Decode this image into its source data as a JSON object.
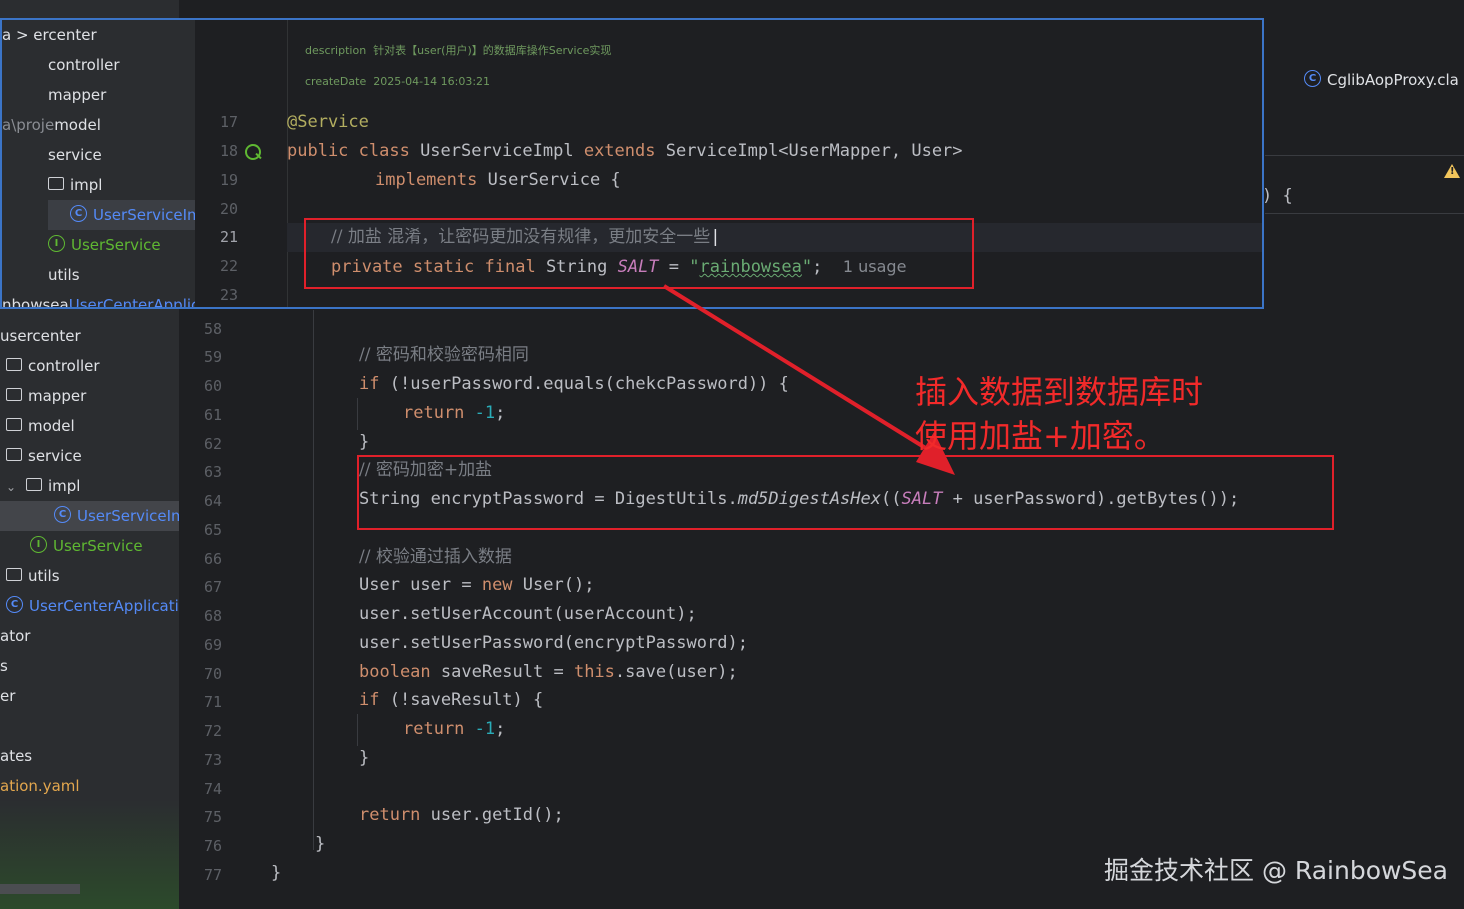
{
  "colors": {
    "annotation_red": "#e0202a",
    "keyword": "#cf8e6d",
    "string": "#6aab73",
    "comment": "#7a7e85",
    "number": "#2aacb8",
    "field": "#c77dbb",
    "class_icon": "#548af7",
    "interface_icon": "#5fb832"
  },
  "popup": {
    "sidebar": {
      "items": [
        {
          "label": "a  >  ",
          "label2": "ercenter"
        },
        {
          "label": "controller"
        },
        {
          "label": "mapper"
        },
        {
          "label": "a\\proje",
          "label2": "model"
        },
        {
          "label": "service"
        },
        {
          "label": "impl",
          "icon": "folder-icon"
        },
        {
          "label": "UserServiceIm",
          "icon": "class-icon"
        },
        {
          "label": "UserService",
          "icon": "interface-icon"
        },
        {
          "label": "utils"
        },
        {
          "label": "nbowsea",
          "label2": "UserCenterApplicati"
        }
      ]
    },
    "doc": {
      "description_label": "description",
      "description_value": "针对表【user(用户)】的数据库操作Service实现",
      "createdate_label": "createDate",
      "createdate_value": "2025-04-14 16:03:21"
    },
    "line_numbers": [
      "17",
      "18",
      "19",
      "20",
      "21",
      "22",
      "23"
    ],
    "code": {
      "l17": "@Service",
      "l18_kw1": "public class",
      "l18_name": " UserServiceImpl ",
      "l18_kw2": "extends",
      "l18_rest": " ServiceImpl<UserMapper, User>",
      "l19_kw": "implements",
      "l19_rest": " UserService {",
      "l21_comment": "// 加盐 混淆，让密码更加没有规律，更加安全一些",
      "l22_kw": "private static final",
      "l22_type": " String ",
      "l22_field": "SALT",
      "l22_eq": " = ",
      "l22_str_open": "\"",
      "l22_str": "rainbowsea",
      "l22_str_close": "\"",
      "l22_semi": ";",
      "l22_usage": "1 usage"
    }
  },
  "sidebar": {
    "items": [
      {
        "label": "usercenter"
      },
      {
        "label": "controller",
        "icon": "folder-icon"
      },
      {
        "label": "mapper",
        "icon": "folder-icon"
      },
      {
        "label": "model",
        "icon": "folder-icon"
      },
      {
        "label": "service",
        "icon": "folder-icon"
      },
      {
        "label": "impl",
        "icon": "folder-icon"
      },
      {
        "label": "UserServiceIm",
        "icon": "class-icon"
      },
      {
        "label": "UserService",
        "icon": "interface-icon"
      },
      {
        "label": "utils",
        "icon": "folder-icon"
      },
      {
        "label": "UserCenterApplicati",
        "icon": "class-icon"
      },
      {
        "label": "ator"
      },
      {
        "label": "s"
      },
      {
        "label": "er"
      },
      {
        "label": "ates"
      },
      {
        "label": "ation.yaml"
      }
    ]
  },
  "gutter": {
    "line_numbers": [
      "58",
      "59",
      "60",
      "61",
      "62",
      "63",
      "64",
      "65",
      "66",
      "67",
      "68",
      "69",
      "70",
      "71",
      "72",
      "73",
      "74",
      "75",
      "76",
      "77"
    ]
  },
  "code": {
    "c59": "// 密码和校验密码相同",
    "l60_kw": "if",
    "l60_rest": " (!userPassword.equals(chekcPassword)) {",
    "l61_kw": "return",
    "l61_num": "-1",
    "l61_semi": ";",
    "l62": "}",
    "c63": "// 密码加密+加盐",
    "l64_a": "String encryptPassword = DigestUtils.",
    "l64_m": "md5DigestAsHex",
    "l64_b": "((",
    "l64_f": "SALT",
    "l64_c": " + userPassword).getBytes());",
    "c66": "// 校验通过插入数据",
    "l67_a": "User user = ",
    "l67_kw": "new",
    "l67_b": " User();",
    "l68": "user.setUserAccount(userAccount);",
    "l69": "user.setUserPassword(encryptPassword);",
    "l70_kw": "boolean",
    "l70_a": " saveResult = ",
    "l70_kw2": "this",
    "l70_b": ".save(user);",
    "l71_kw": "if",
    "l71_rest": " (!saveResult) {",
    "l72_kw": "return",
    "l72_num": "-1",
    "l72_semi": ";",
    "l73": "}",
    "l75_kw": "return",
    "l75_rest": " user.getId();",
    "l76": "}",
    "l77": "}"
  },
  "right": {
    "tab_label": "CglibAopProxy.cla",
    "brace_peek": ") {"
  },
  "annotation": {
    "line1": "插入数据到数据库时",
    "line2": "使用加盐+加密。"
  },
  "watermark": "掘金技术社区 @ RainbowSea"
}
